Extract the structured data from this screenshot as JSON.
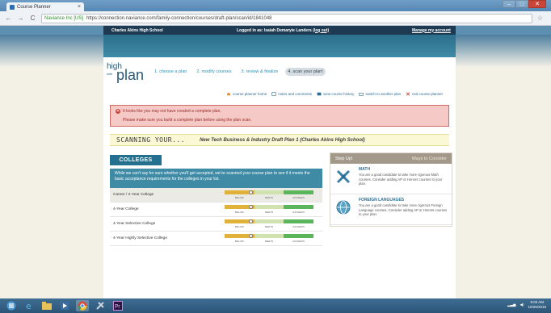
{
  "browser": {
    "tab_title": "Course Planner",
    "tab_close": "×",
    "back": "←",
    "forward": "→",
    "reload": "C",
    "secure_label": "Naviance Inc [US]",
    "url": "https://connection.naviance.com/family-connection/courses/draft-plan/scan/id/1841048",
    "star": "☆"
  },
  "site_header": {
    "school": "Charles Akins High School",
    "logged_in_as": "Logged in as: Isaiah Demaryie Landers",
    "logout": "(log out)",
    "manage_account": "Manage my account"
  },
  "logo": {
    "high": "high",
    "with": "with",
    "plan": "plan"
  },
  "steps": [
    {
      "label": "1. choose a plan",
      "active": false
    },
    {
      "label": "2. modify courses",
      "active": false
    },
    {
      "label": "3. review & finalize",
      "active": false
    },
    {
      "label": "4. scan your plan!",
      "active": true
    }
  ],
  "subnav": [
    {
      "label": "course planner home",
      "icon": "home-icon"
    },
    {
      "label": "notes and comments",
      "icon": "notes-icon"
    },
    {
      "label": "view course history",
      "icon": "history-icon"
    },
    {
      "label": "switch to another plan",
      "icon": "switch-icon"
    },
    {
      "label": "exit course planner",
      "icon": "exit-icon"
    }
  ],
  "alert": {
    "title": "It looks like you may not have created a complete plan.",
    "description": "Please make sure you build a complete plan before using the plan scan.",
    "color": "#f5c9c6"
  },
  "scanning": {
    "label": "SCANNING YOUR...",
    "plan_name": "New Tech Business & Industry Draft Plan 1 (Charles Akins High School)"
  },
  "colleges": {
    "title": "COLLEGES",
    "description": "While we can't say for sure whether you'll get accepted, we've scanned your course plan to see if it meets the basic acceptance requirements for the colleges in your list.",
    "meter_labels": [
      "BELOW",
      "MEETS",
      "EXCEEDS"
    ],
    "rows": [
      {
        "name": "Career / 2-Year College",
        "level": 0.33
      },
      {
        "name": "4-Year College",
        "level": 0.33
      },
      {
        "name": "4-Year Selective College",
        "level": 0.33
      },
      {
        "name": "4-Year Highly Selective College",
        "level": 0.33
      }
    ]
  },
  "stay_up": {
    "tab_active": "Step Up!",
    "tab_inactive": "Ways to Consider",
    "items": [
      {
        "title": "MATH",
        "text": "You are a good candidate to take more rigorous Math courses. Consider adding AP or Honors courses to your plan.",
        "icon": "math-tools-icon"
      },
      {
        "title": "FOREIGN LANGUAGES",
        "text": "You are a good candidate to take more rigorous Foreign Language courses. Consider adding AP or Honors courses to your plan.",
        "icon": "globe-icon"
      }
    ]
  },
  "taskbar": {
    "time": "9:02 AM",
    "date": "10/26/2016"
  }
}
